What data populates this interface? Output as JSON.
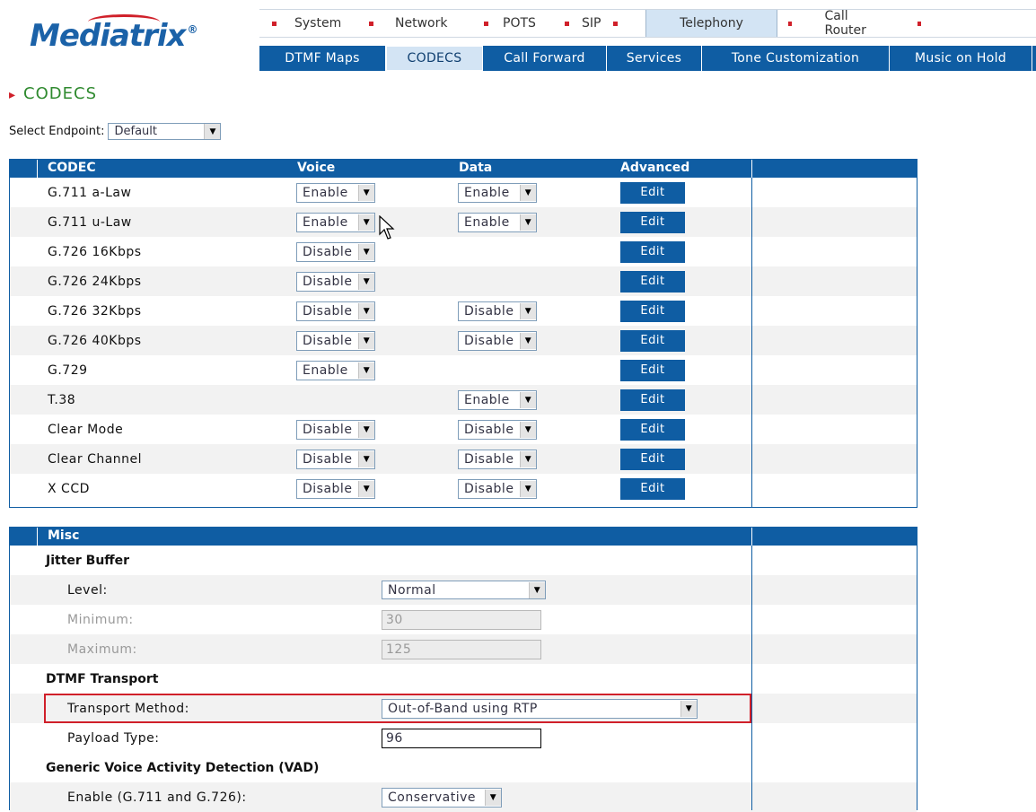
{
  "brand": {
    "logo_text": "Mediatrix",
    "trademark": "®"
  },
  "top_nav": [
    {
      "label": "System",
      "active": false
    },
    {
      "label": "Network",
      "active": false
    },
    {
      "label": "POTS",
      "active": false
    },
    {
      "label": "SIP",
      "active": false
    },
    {
      "label": "Telephony",
      "active": true
    },
    {
      "label": "Call Router",
      "active": false
    }
  ],
  "sub_nav": [
    {
      "label": "DTMF Maps",
      "active": false
    },
    {
      "label": "CODECS",
      "active": true
    },
    {
      "label": "Call Forward",
      "active": false
    },
    {
      "label": "Services",
      "active": false
    },
    {
      "label": "Tone Customization",
      "active": false
    },
    {
      "label": "Music on Hold",
      "active": false
    }
  ],
  "page": {
    "title": "CODECS"
  },
  "endpoint": {
    "label": "Select Endpoint:",
    "value": "Default"
  },
  "codec_table": {
    "headers": {
      "codec": "CODEC",
      "voice": "Voice",
      "data": "Data",
      "advanced": "Advanced"
    },
    "edit_label": "Edit",
    "rows": [
      {
        "codec": "G.711 a-Law",
        "voice": "Enable",
        "data": "Enable"
      },
      {
        "codec": "G.711 u-Law",
        "voice": "Enable",
        "data": "Enable"
      },
      {
        "codec": "G.726 16Kbps",
        "voice": "Disable",
        "data": ""
      },
      {
        "codec": "G.726 24Kbps",
        "voice": "Disable",
        "data": ""
      },
      {
        "codec": "G.726 32Kbps",
        "voice": "Disable",
        "data": "Disable"
      },
      {
        "codec": "G.726 40Kbps",
        "voice": "Disable",
        "data": "Disable"
      },
      {
        "codec": "G.729",
        "voice": "Enable",
        "data": ""
      },
      {
        "codec": "T.38",
        "voice": "",
        "data": "Enable"
      },
      {
        "codec": "Clear Mode",
        "voice": "Disable",
        "data": "Disable"
      },
      {
        "codec": "Clear Channel",
        "voice": "Disable",
        "data": "Disable"
      },
      {
        "codec": "X CCD",
        "voice": "Disable",
        "data": "Disable"
      }
    ]
  },
  "misc": {
    "header": "Misc",
    "jitter_buffer": {
      "title": "Jitter Buffer",
      "level_label": "Level:",
      "level_value": "Normal",
      "min_label": "Minimum:",
      "min_value": "30",
      "max_label": "Maximum:",
      "max_value": "125"
    },
    "dtmf": {
      "title": "DTMF Transport",
      "method_label": "Transport Method:",
      "method_value": "Out-of-Band using RTP",
      "payload_label": "Payload Type:",
      "payload_value": "96"
    },
    "vad": {
      "title": "Generic Voice Activity Detection (VAD)",
      "enable_label": "Enable (G.711 and G.726):",
      "enable_value": "Conservative"
    }
  },
  "colors": {
    "brand_blue": "#0f5da3",
    "accent_red": "#d0202a",
    "title_green": "#2f8a2f",
    "row_alt": "#f2f2f2"
  }
}
